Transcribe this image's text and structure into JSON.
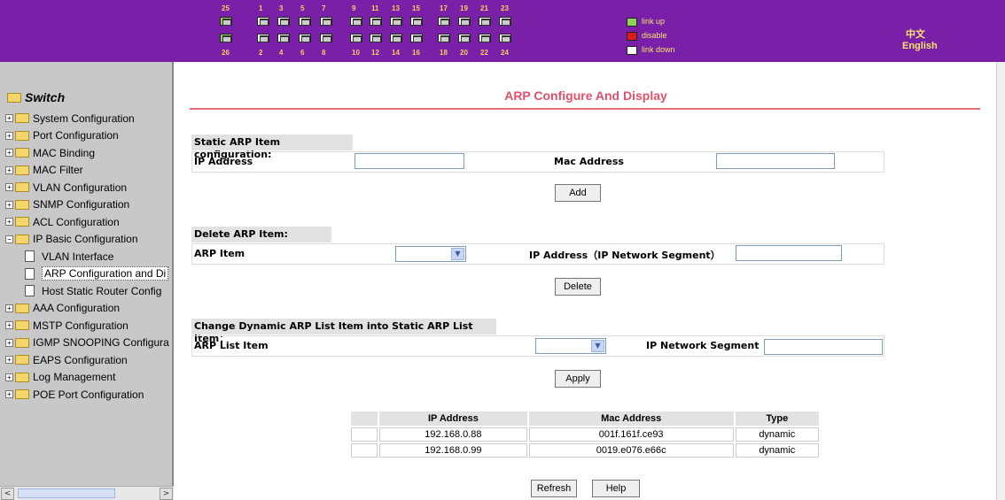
{
  "header": {
    "top_numbers": [
      "25",
      "1",
      "3",
      "5",
      "7",
      "9",
      "11",
      "13",
      "15",
      "17",
      "19",
      "21",
      "23"
    ],
    "bottom_numbers": [
      "26",
      "2",
      "4",
      "6",
      "8",
      "10",
      "12",
      "14",
      "16",
      "18",
      "20",
      "22",
      "24"
    ],
    "legend": {
      "up": "link up",
      "disable": "disable",
      "down": "link down"
    },
    "lang_cn": "中文",
    "lang_en": "English",
    "colors": {
      "bar": "#7a1fa8",
      "up": "#8fd35a",
      "disable": "#d81c1c",
      "down": "#ffffff"
    }
  },
  "sidebar": {
    "root": "Switch",
    "items": [
      {
        "label": "System Configuration",
        "type": "folder"
      },
      {
        "label": "Port Configuration",
        "type": "folder"
      },
      {
        "label": "MAC Binding",
        "type": "folder"
      },
      {
        "label": "MAC Filter",
        "type": "folder"
      },
      {
        "label": "VLAN Configuration",
        "type": "folder"
      },
      {
        "label": "SNMP Configuration",
        "type": "folder"
      },
      {
        "label": "ACL Configuration",
        "type": "folder"
      },
      {
        "label": "IP Basic Configuration",
        "type": "folder-open"
      },
      {
        "label": "VLAN Interface",
        "type": "doc"
      },
      {
        "label": "ARP Configuration and Di",
        "type": "doc",
        "selected": true
      },
      {
        "label": "Host Static Router Config",
        "type": "doc"
      },
      {
        "label": "AAA Configuration",
        "type": "folder"
      },
      {
        "label": "MSTP Configuration",
        "type": "folder"
      },
      {
        "label": "IGMP SNOOPING Configura",
        "type": "folder"
      },
      {
        "label": "EAPS Configuration",
        "type": "folder"
      },
      {
        "label": "Log Management",
        "type": "folder"
      },
      {
        "label": "POE Port Configuration",
        "type": "folder"
      }
    ]
  },
  "main": {
    "title": "ARP Configure And Display",
    "static_section": {
      "heading": "Static ARP Item configuration:",
      "ip_label": "IP Address",
      "ip_value": "",
      "mac_label": "Mac Address",
      "mac_value": "",
      "add_button": "Add"
    },
    "delete_section": {
      "heading": "Delete ARP Item:",
      "item_label": "ARP Item",
      "item_value": "",
      "ip_label": "IP Address（IP Network Segment）",
      "ip_value": "",
      "delete_button": "Delete"
    },
    "change_section": {
      "heading": "Change Dynamic ARP List Item into Static ARP List Item：",
      "list_label": "ARP List Item",
      "list_value": "",
      "segment_label": "IP Network Segment",
      "segment_value": "",
      "apply_button": "Apply"
    },
    "table": {
      "headers": [
        "",
        "IP Address",
        "Mac Address",
        "Type"
      ],
      "rows": [
        {
          "ip": "192.168.0.88",
          "mac": "001f.161f.ce93",
          "type": "dynamic"
        },
        {
          "ip": "192.168.0.99",
          "mac": "0019.e076.e66c",
          "type": "dynamic"
        }
      ]
    },
    "refresh_button": "Refresh",
    "help_button": "Help"
  }
}
